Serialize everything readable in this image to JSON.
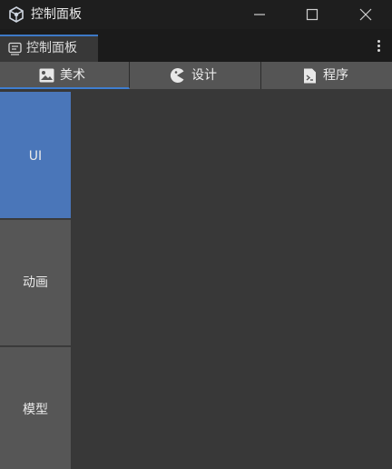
{
  "window": {
    "title": "控制面板"
  },
  "doc_tab": {
    "label": "控制面板"
  },
  "category_tabs": [
    {
      "label": "美术",
      "icon": "image-icon",
      "active": true
    },
    {
      "label": "设计",
      "icon": "pacman-icon",
      "active": false
    },
    {
      "label": "程序",
      "icon": "script-icon",
      "active": false
    }
  ],
  "sidebar": {
    "items": [
      {
        "label": "UI",
        "selected": true
      },
      {
        "label": "动画",
        "selected": false
      },
      {
        "label": "模型",
        "selected": false
      }
    ]
  },
  "colors": {
    "accent": "#3f7ed0",
    "selected_item": "#4a76b9",
    "panel": "#383838"
  }
}
